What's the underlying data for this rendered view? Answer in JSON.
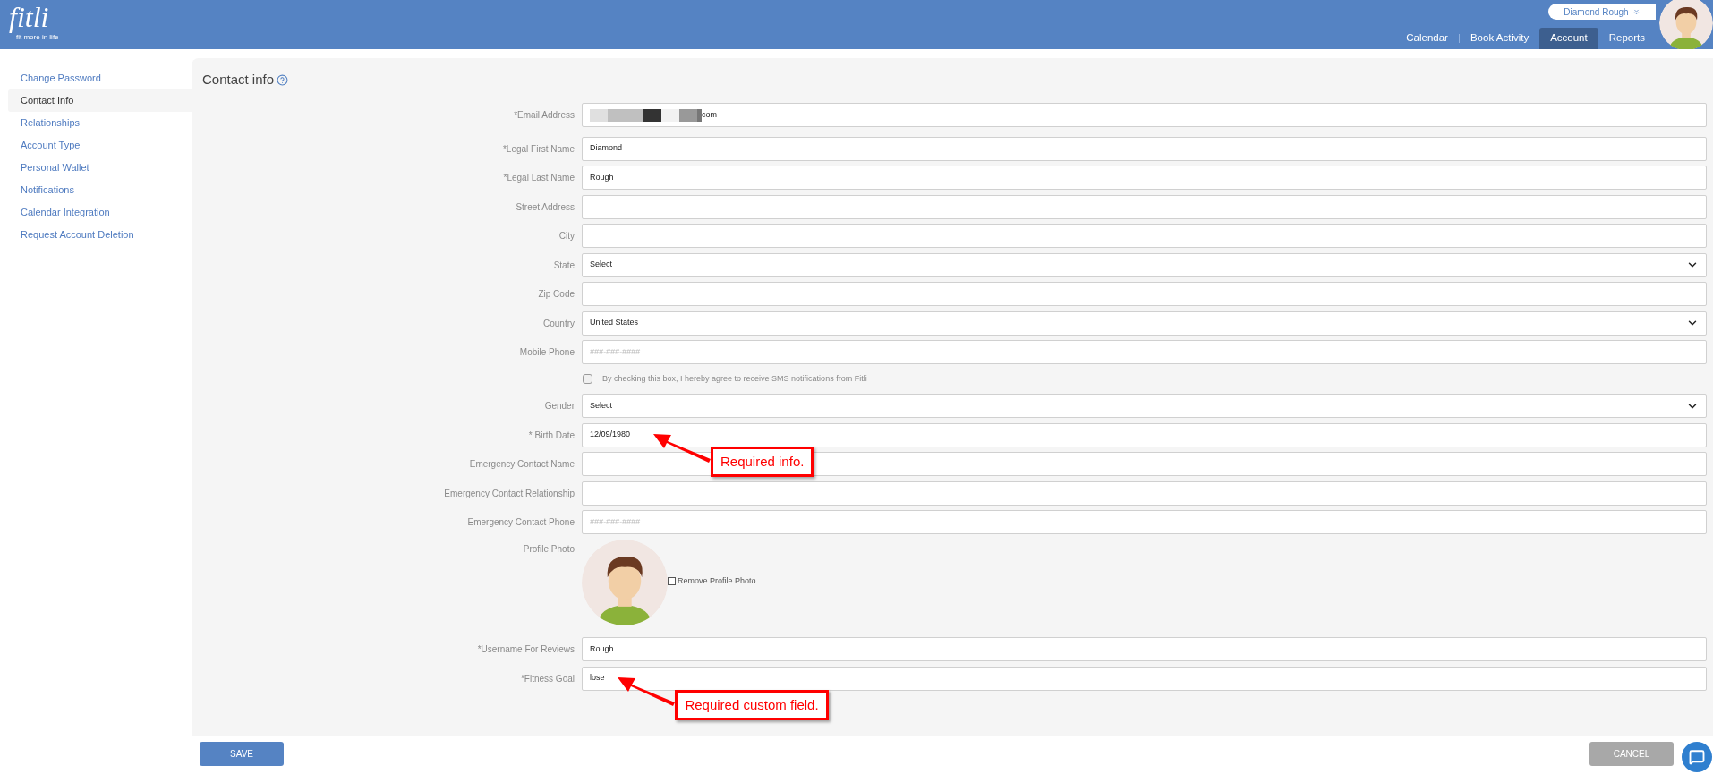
{
  "header": {
    "logo": "fitli",
    "tagline": "fit more in life",
    "user_menu": "Diamond Rough",
    "nav": [
      {
        "label": "Calendar",
        "selected": false
      },
      {
        "label": "Book Activity",
        "selected": false
      },
      {
        "label": "Account",
        "selected": true
      },
      {
        "label": "Reports",
        "selected": false
      }
    ]
  },
  "sidebar": {
    "items": [
      {
        "label": "Change Password",
        "selected": false
      },
      {
        "label": "Contact Info",
        "selected": true
      },
      {
        "label": "Relationships",
        "selected": false
      },
      {
        "label": "Account Type",
        "selected": false
      },
      {
        "label": "Personal Wallet",
        "selected": false
      },
      {
        "label": "Notifications",
        "selected": false
      },
      {
        "label": "Calendar Integration",
        "selected": false
      },
      {
        "label": "Request Account Deletion",
        "selected": false
      }
    ]
  },
  "form": {
    "title": "Contact info",
    "fields": [
      {
        "kind": "email",
        "label": "*Email Address",
        "value": "com"
      },
      {
        "kind": "text",
        "label": "*Legal First Name",
        "value": "Diamond"
      },
      {
        "kind": "text",
        "label": "*Legal Last Name",
        "value": "Rough"
      },
      {
        "kind": "text",
        "label": "Street Address"
      },
      {
        "kind": "text",
        "label": "City"
      },
      {
        "kind": "select",
        "label": "State",
        "value": "Select"
      },
      {
        "kind": "text",
        "label": "Zip Code"
      },
      {
        "kind": "select",
        "label": "Country",
        "value": "United States"
      },
      {
        "kind": "text",
        "label": "Mobile Phone",
        "placeholder": "###-###-####"
      },
      {
        "kind": "checkbox",
        "label": "By checking this box, I hereby agree to receive SMS notifications from Fitli",
        "checked": false
      },
      {
        "kind": "select",
        "label": "Gender",
        "value": "Select"
      },
      {
        "kind": "text",
        "label": "* Birth Date",
        "value": "12/09/1980",
        "annotation": "Required info."
      },
      {
        "kind": "text",
        "label": "Emergency Contact Name"
      },
      {
        "kind": "text",
        "label": "Emergency Contact Relationship"
      },
      {
        "kind": "text",
        "label": "Emergency Contact Phone",
        "placeholder": "###-###-####"
      },
      {
        "kind": "photo",
        "label": "Profile Photo",
        "remove_label": "Remove Profile Photo",
        "checked": false
      },
      {
        "kind": "text",
        "label": "*Username For Reviews",
        "value": "Rough"
      },
      {
        "kind": "text",
        "label": "*Fitness Goal",
        "value": "lose",
        "annotation": "Required custom field."
      }
    ]
  },
  "footer": {
    "buttons": [
      {
        "label": "SAVE",
        "disabled": false
      },
      {
        "label": "CANCEL",
        "disabled": true
      }
    ]
  }
}
